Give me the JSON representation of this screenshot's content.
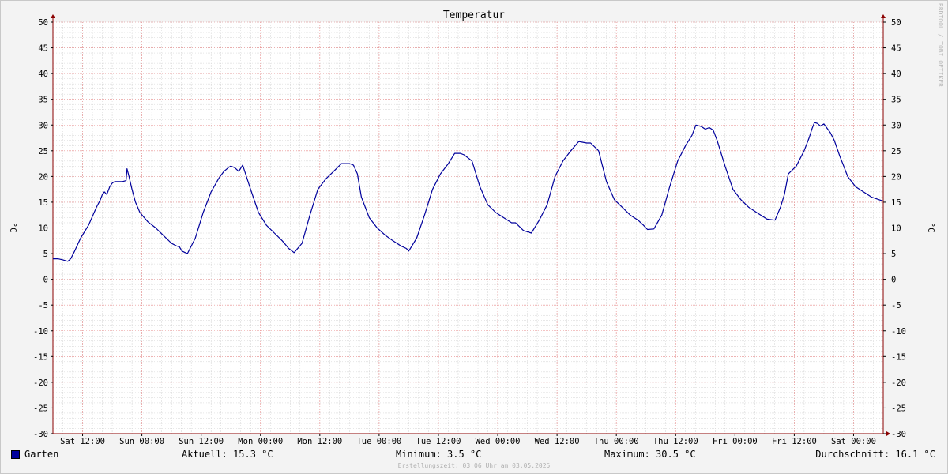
{
  "chart_data": {
    "type": "line",
    "title": "Temperatur",
    "ylabel": "°C",
    "ylabel_right": "°C",
    "ylim": [
      -30,
      50
    ],
    "y_ticks": [
      50,
      45,
      40,
      35,
      30,
      25,
      20,
      15,
      10,
      5,
      0,
      -5,
      -10,
      -15,
      -20,
      -25,
      -30
    ],
    "x_unit": "hours",
    "xlim": [
      0,
      168
    ],
    "x_ticks": [
      {
        "x": 6,
        "label": "Sat 12:00"
      },
      {
        "x": 18,
        "label": "Sun 00:00"
      },
      {
        "x": 30,
        "label": "Sun 12:00"
      },
      {
        "x": 42,
        "label": "Mon 00:00"
      },
      {
        "x": 54,
        "label": "Mon 12:00"
      },
      {
        "x": 66,
        "label": "Tue 00:00"
      },
      {
        "x": 78,
        "label": "Tue 12:00"
      },
      {
        "x": 90,
        "label": "Wed 00:00"
      },
      {
        "x": 102,
        "label": "Wed 12:00"
      },
      {
        "x": 114,
        "label": "Thu 00:00"
      },
      {
        "x": 126,
        "label": "Thu 12:00"
      },
      {
        "x": 138,
        "label": "Fri 00:00"
      },
      {
        "x": 150,
        "label": "Fri 12:00"
      },
      {
        "x": 162,
        "label": "Sat 00:00"
      }
    ],
    "grid": true,
    "legend": "bottom-left",
    "colors": {
      "line": "#00009c",
      "grid_major": "#e88a8a",
      "grid_minor": "#d0d0d0",
      "axis": "#8b0000",
      "background": "#ffffff"
    },
    "series": [
      {
        "name": "Garten",
        "x": [
          0,
          1,
          2,
          3,
          3.6,
          4.4,
          5.6,
          7.2,
          8.8,
          9.6,
          10,
          10.4,
          10.9,
          11.5,
          12,
          12.5,
          13,
          14,
          14.8,
          15,
          15.4,
          16,
          16.7,
          17.6,
          19.2,
          20.8,
          22.4,
          24,
          25,
          25.6,
          26.1,
          27.2,
          28.8,
          30.4,
          32,
          33.6,
          34.6,
          35.6,
          36,
          36.8,
          37.6,
          38.4,
          40,
          41.6,
          43.2,
          44.8,
          46.4,
          47.1,
          47.7,
          48.8,
          50.4,
          52,
          53.6,
          55.2,
          56.8,
          58.4,
          59.2,
          60,
          60.8,
          61.6,
          62.4,
          64,
          65.6,
          67.2,
          68.8,
          70.4,
          71.5,
          72,
          73.6,
          75.2,
          76.8,
          78.4,
          80,
          81.3,
          82.4,
          83.2,
          84.8,
          86.4,
          88,
          89.6,
          91.2,
          92.8,
          93.6,
          95.2,
          96.8,
          98.4,
          100,
          101.6,
          103.2,
          104.8,
          106.4,
          108,
          108.8,
          110.4,
          112,
          113.6,
          115.2,
          116.8,
          118.4,
          119.5,
          120.3,
          121.6,
          123.2,
          124.8,
          126.4,
          128,
          129.3,
          130.1,
          131.2,
          132,
          132.8,
          133.6,
          134.4,
          136,
          137.6,
          139.2,
          140.8,
          142.4,
          143.7,
          144.5,
          146.1,
          147.2,
          148,
          148.8,
          150.4,
          152,
          153,
          153.6,
          154.1,
          154.7,
          155.3,
          156,
          157.3,
          158.1,
          159.2,
          160,
          160.8,
          162.4,
          164,
          165.6,
          168
        ],
        "values": [
          4,
          4,
          3.8,
          3.5,
          4,
          5.5,
          8,
          10.5,
          14,
          15.5,
          16.5,
          17,
          16.5,
          18,
          18.7,
          19,
          19,
          19,
          19.2,
          21.5,
          20,
          17.5,
          15,
          13,
          11.2,
          10,
          8.5,
          7,
          6.5,
          6.3,
          5.5,
          5,
          8,
          13,
          17,
          19.7,
          21,
          21.8,
          22,
          21.7,
          21,
          22.2,
          17.5,
          13,
          10.5,
          9,
          7.5,
          6.7,
          6,
          5.2,
          7,
          12.5,
          17.5,
          19.5,
          21,
          22.5,
          22.5,
          22.5,
          22.2,
          20.5,
          16,
          12,
          10,
          8.6,
          7.5,
          6.5,
          6,
          5.5,
          8,
          12.5,
          17.5,
          20.5,
          22.5,
          24.5,
          24.5,
          24.2,
          23,
          18,
          14.5,
          13,
          12,
          11,
          11,
          9.5,
          9,
          11.5,
          14.5,
          20,
          23,
          25,
          26.8,
          26.5,
          26.5,
          25,
          19,
          15.5,
          14,
          12.5,
          11.5,
          10.5,
          9.7,
          9.8,
          12.5,
          18,
          23,
          26,
          28,
          30,
          29.7,
          29.2,
          29.5,
          29,
          27,
          22,
          17.5,
          15.5,
          14,
          13,
          12.2,
          11.7,
          11.5,
          14,
          16.5,
          20.5,
          22,
          25,
          27.5,
          29.3,
          30.5,
          30.3,
          29.8,
          30.2,
          28.5,
          27,
          24,
          22,
          20,
          18,
          17,
          16,
          15.2
        ]
      }
    ]
  },
  "legend": {
    "label": "Garten",
    "color": "#00009c"
  },
  "stats": {
    "current": "Aktuell: 15.3 °C",
    "minimum": "Minimum: 3.5 °C",
    "maximum": "Maximum: 30.5 °C",
    "average": "Durchschnitt: 16.1 °C"
  },
  "created": "Erstellungszeit: 03:06 Uhr am 03.05.2025",
  "watermark": "RRDTOOL / TOBI OETIKER"
}
